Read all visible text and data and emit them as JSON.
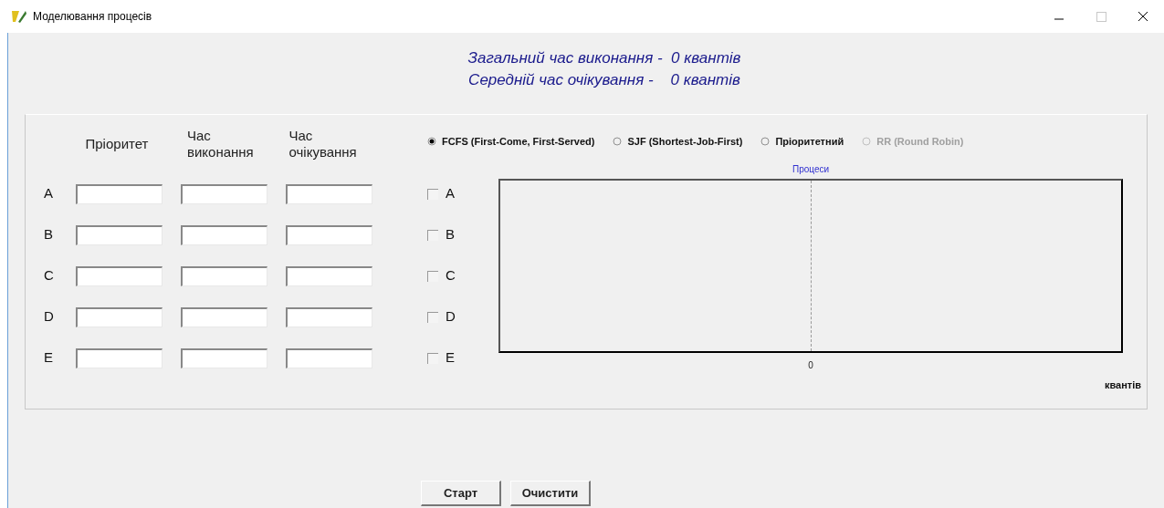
{
  "window": {
    "title": "Моделювання процесів"
  },
  "summary": [
    "Загальний час виконання -  0 квантів",
    "Середній час очікування -    0 квантів"
  ],
  "table": {
    "columns": [
      "Пріоритет",
      "Час виконання",
      "Час очікування"
    ],
    "rows": [
      {
        "label": "A"
      },
      {
        "label": "B"
      },
      {
        "label": "C"
      },
      {
        "label": "D"
      },
      {
        "label": "E"
      }
    ]
  },
  "algorithms": [
    {
      "label": "FCFS (First-Come, First-Served)",
      "selected": true,
      "disabled": false
    },
    {
      "label": "SJF (Shortest-Job-First)",
      "selected": false,
      "disabled": false
    },
    {
      "label": "Пріоритетний",
      "selected": false,
      "disabled": false
    },
    {
      "label": "RR (Round Robin)",
      "selected": false,
      "disabled": true
    }
  ],
  "processes": [
    {
      "label": "A",
      "checked": false
    },
    {
      "label": "B",
      "checked": false
    },
    {
      "label": "C",
      "checked": false
    },
    {
      "label": "D",
      "checked": false
    },
    {
      "label": "E",
      "checked": false
    }
  ],
  "plot": {
    "title": "Процеси",
    "tick": "0",
    "unit": "квантів"
  },
  "buttons": [
    "Старт",
    "Очистити"
  ]
}
